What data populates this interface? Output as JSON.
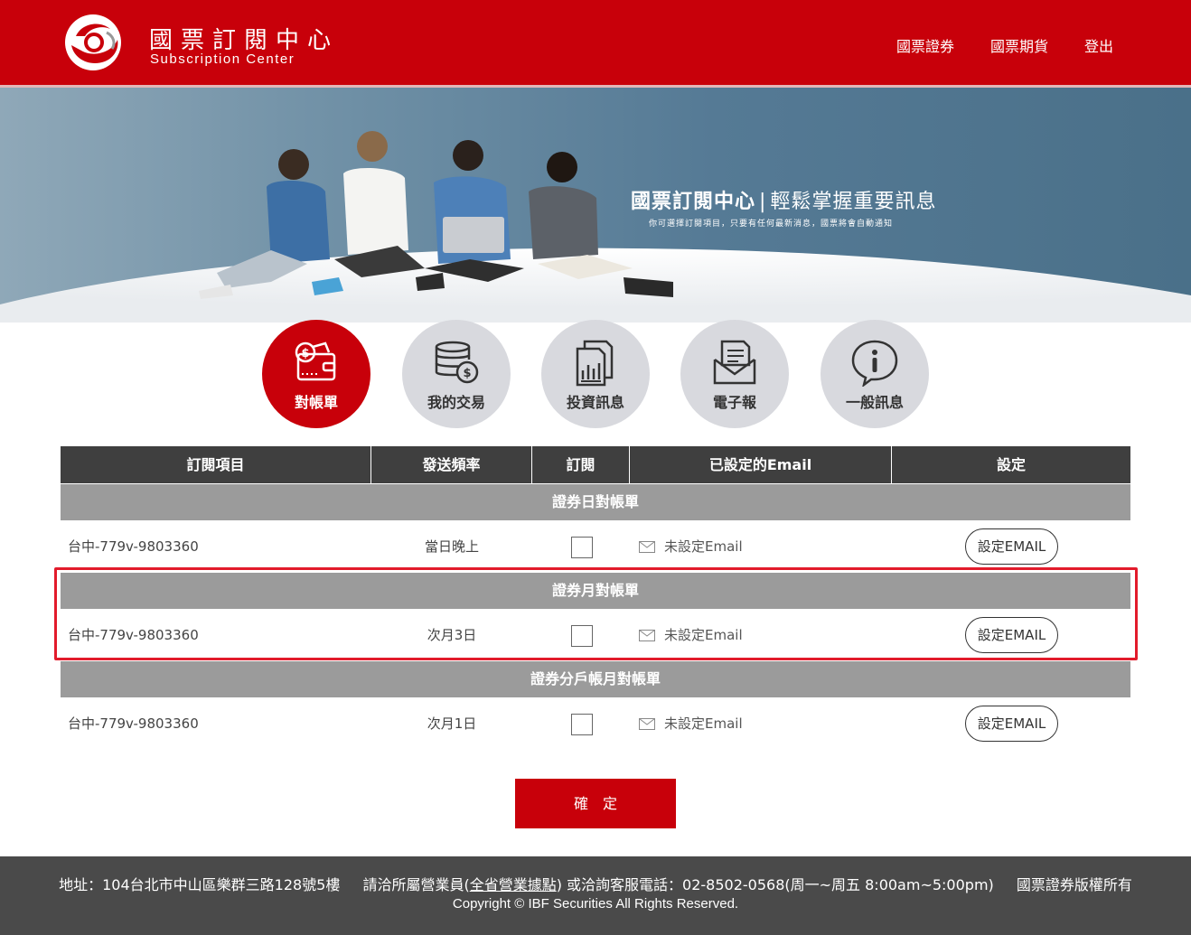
{
  "header": {
    "brand_cn": "國票訂閱中心",
    "brand_en": "Subscription Center",
    "nav": [
      "國票證券",
      "國票期貨",
      "登出"
    ]
  },
  "hero": {
    "title_bold": "國票訂閱中心",
    "title_sep": "|",
    "title_light": "輕鬆掌握重要訊息",
    "subtitle": "你可選擇訂閱項目，只要有任何最新消息，國票將會自動通知"
  },
  "categories": [
    {
      "label": "對帳單",
      "icon": "wallet-dollar-icon",
      "active": true
    },
    {
      "label": "我的交易",
      "icon": "coin-stack-icon",
      "active": false
    },
    {
      "label": "投資訊息",
      "icon": "chart-document-icon",
      "active": false
    },
    {
      "label": "電子報",
      "icon": "envelope-letter-icon",
      "active": false
    },
    {
      "label": "一般訊息",
      "icon": "info-bubble-icon",
      "active": false
    }
  ],
  "table": {
    "headers": [
      "訂閱項目",
      "發送頻率",
      "訂閱",
      "已設定的Email",
      "設定"
    ],
    "sections": [
      {
        "title": "證券日對帳單",
        "row": {
          "account": "台中-779v-9803360",
          "frequency": "當日晚上",
          "email": "未設定Email",
          "button": "設定EMAIL"
        }
      },
      {
        "title": "證券月對帳單",
        "row": {
          "account": "台中-779v-9803360",
          "frequency": "次月3日",
          "email": "未設定Email",
          "button": "設定EMAIL"
        }
      },
      {
        "title": "證券分戶帳月對帳單",
        "row": {
          "account": "台中-779v-9803360",
          "frequency": "次月1日",
          "email": "未設定Email",
          "button": "設定EMAIL"
        }
      }
    ]
  },
  "confirm_label": "確定",
  "footer": {
    "address": "地址：104台北市中山區樂群三路128號5樓",
    "contact_prefix": "請洽所屬營業員(",
    "contact_link": "全省營業據點",
    "contact_suffix": ") 或洽詢客服電話：02-8502-0568(周一~周五 8:00am~5:00pm)",
    "rights": "國票證券版權所有",
    "copyright": "Copyright © IBF Securities All Rights Reserved."
  },
  "colors": {
    "brand_red": "#c8000a",
    "header_dark": "#3f3f3f",
    "section_gray": "#9b9b9b",
    "footer_gray": "#4a4a4a",
    "highlight_red": "#e21b2b"
  }
}
